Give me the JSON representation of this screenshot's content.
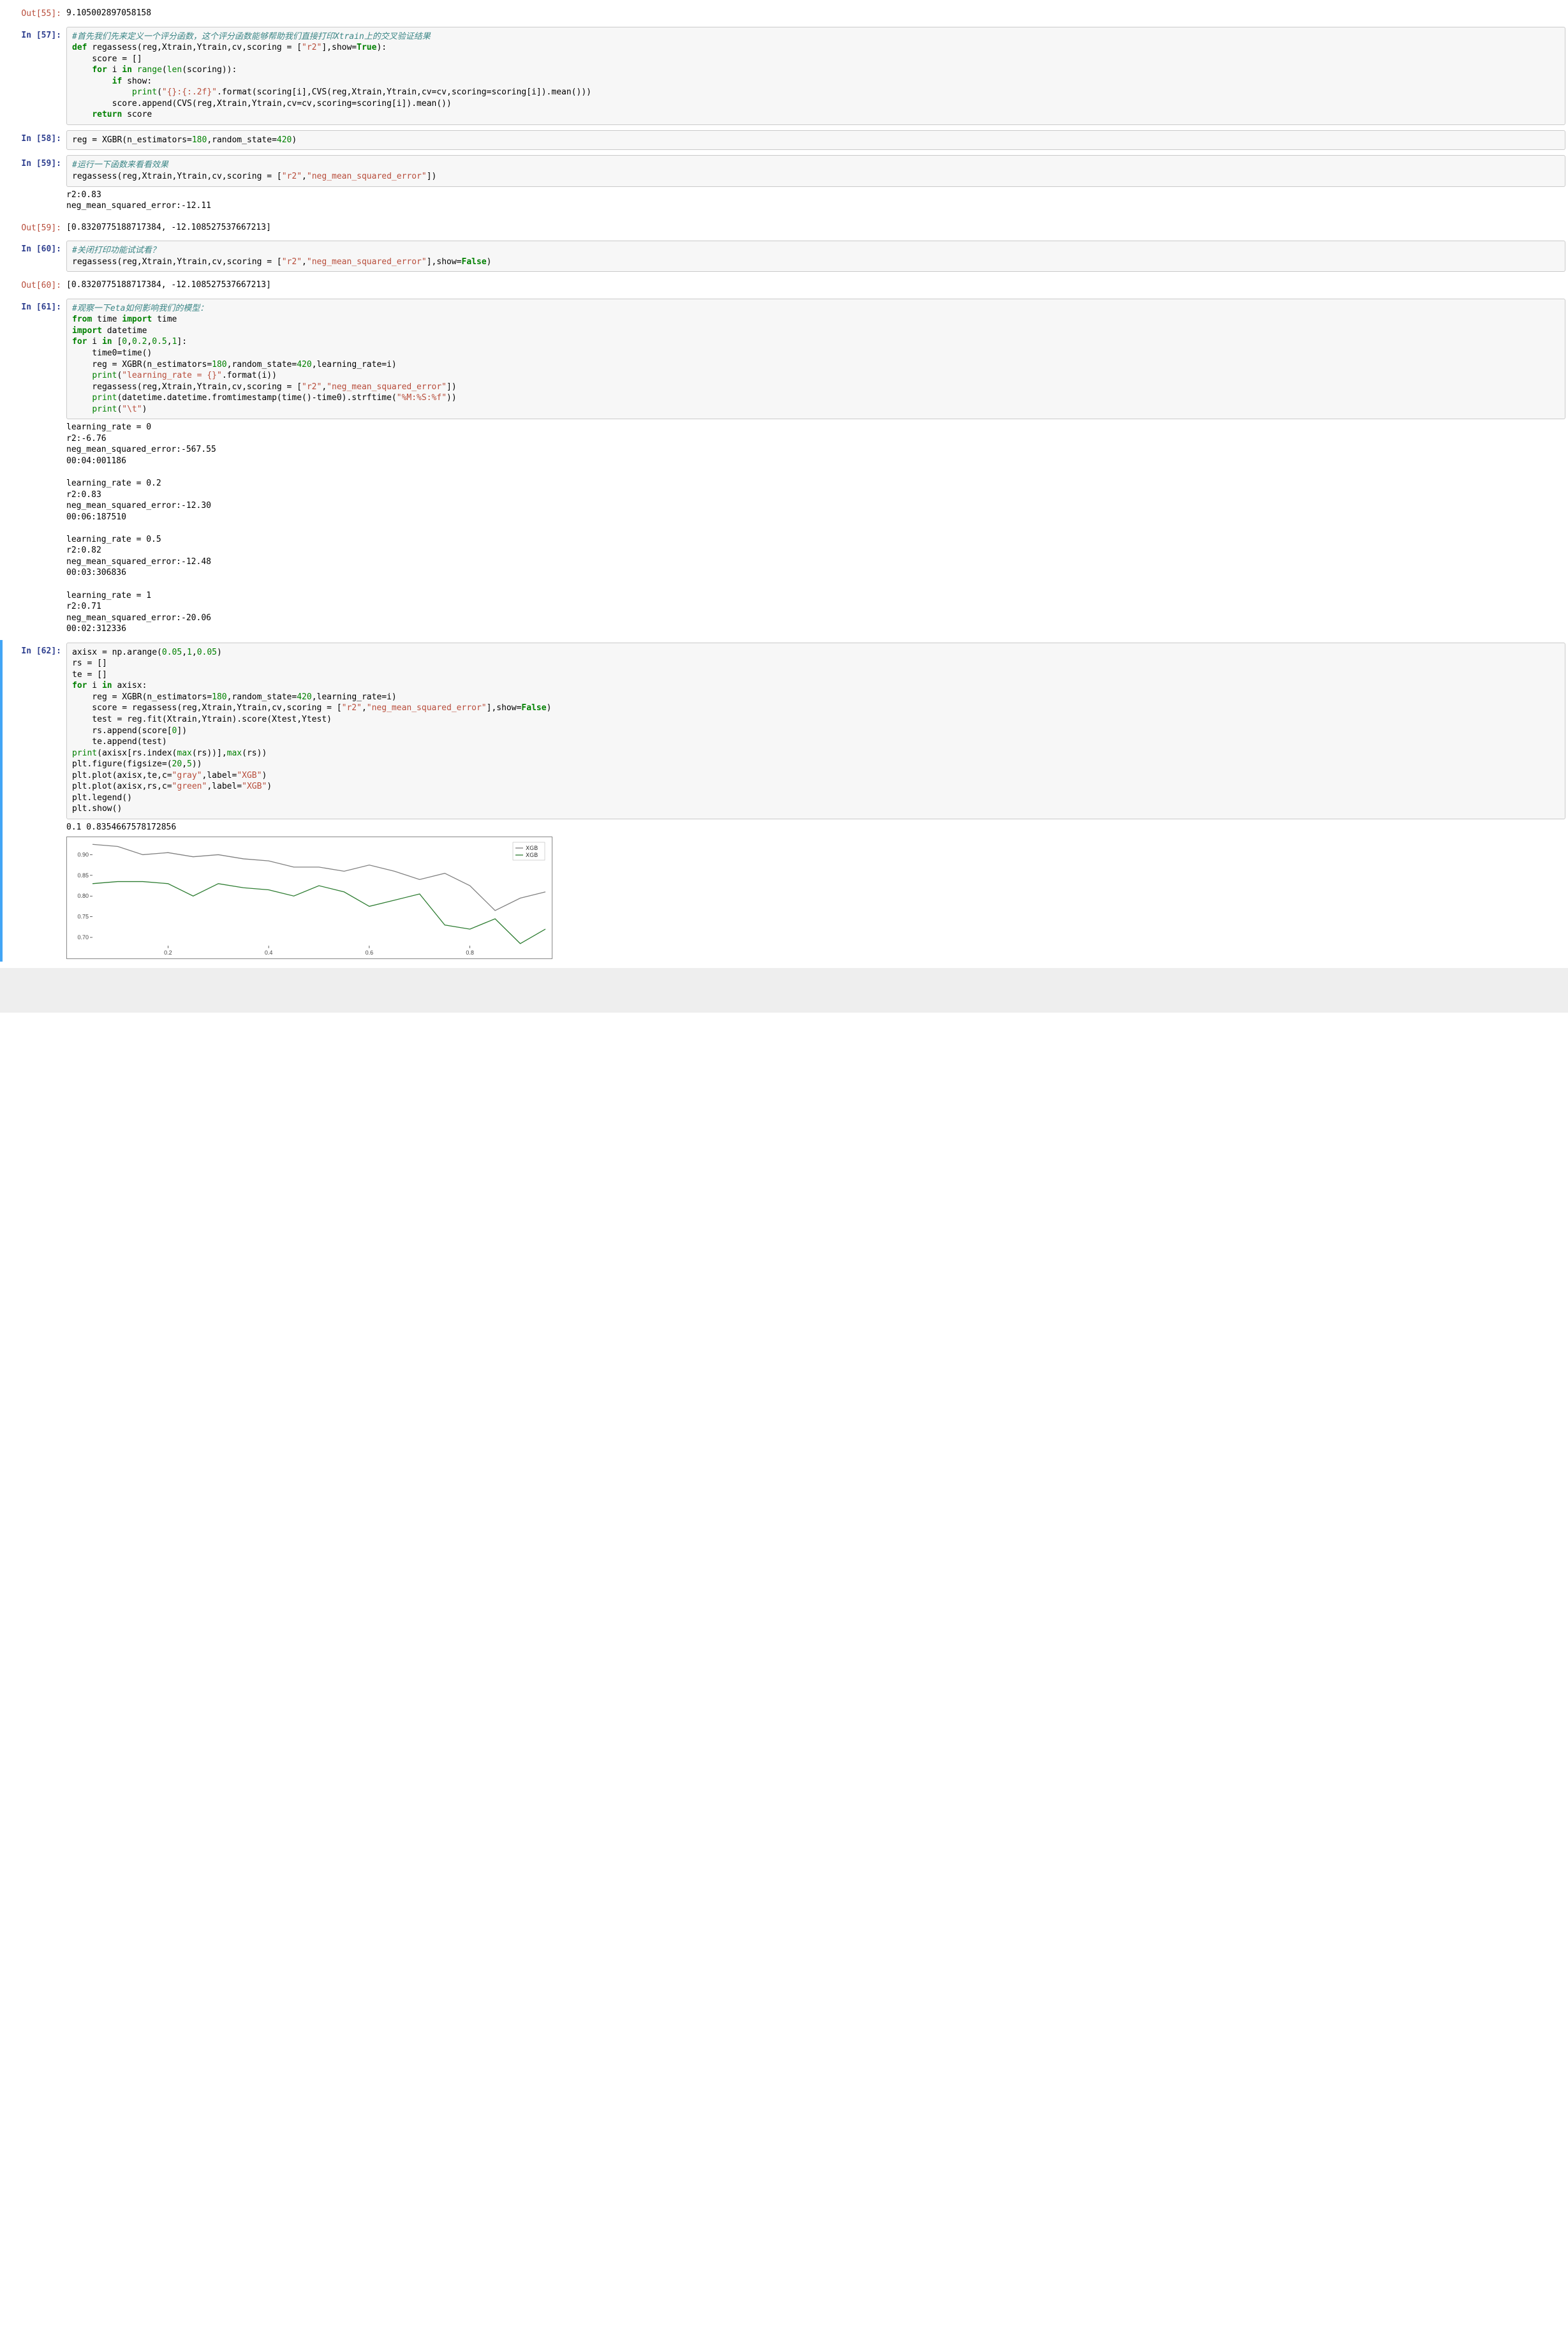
{
  "cells": {
    "out55_prompt": "Out[55]:",
    "out55_text": "9.105002897058158",
    "in57_prompt": "In [57]:",
    "in58_prompt": "In [58]:",
    "in59_prompt": "In [59]:",
    "out59_prompt": "Out[59]:",
    "in60_prompt": "In [60]:",
    "out60_prompt": "Out[60]:",
    "in61_prompt": "In [61]:",
    "in62_prompt": "In [62]:",
    "in57_comment": "#首先我们先来定义一个评分函数，这个评分函数能够帮助我们直接打印Xtrain上的交叉验证结果",
    "in57_l2a": "def",
    "in57_l2b": " regassess(reg,Xtrain,Ytrain,cv,scoring = [",
    "in57_l2c": "\"r2\"",
    "in57_l2d": "],show=",
    "in57_l2e": "True",
    "in57_l2f": "):",
    "in57_l3": "    score = []",
    "in57_l4a": "    ",
    "in57_l4b": "for",
    "in57_l4c": " i ",
    "in57_l4d": "in",
    "in57_l4e": " ",
    "in57_l4f": "range",
    "in57_l4g": "(",
    "in57_l4h": "len",
    "in57_l4i": "(scoring)):",
    "in57_l5a": "        ",
    "in57_l5b": "if",
    "in57_l5c": " show:",
    "in57_l6a": "            ",
    "in57_l6b": "print",
    "in57_l6c": "(",
    "in57_l6d": "\"{}:{:.2f}\"",
    "in57_l6e": ".format(scoring[i],CVS(reg,Xtrain,Ytrain,cv=cv,scoring=scoring[i]).mean()))",
    "in57_l7": "        score.append(CVS(reg,Xtrain,Ytrain,cv=cv,scoring=scoring[i]).mean())",
    "in57_l8a": "    ",
    "in57_l8b": "return",
    "in57_l8c": " score",
    "in58_a": "reg = XGBR(n_estimators=",
    "in58_b": "180",
    "in58_c": ",random_state=",
    "in58_d": "420",
    "in58_e": ")",
    "in59_comment": "#运行一下函数来看看效果",
    "in59_l2a": "regassess(reg,Xtrain,Ytrain,cv,scoring = [",
    "in59_l2b": "\"r2\"",
    "in59_l2c": ",",
    "in59_l2d": "\"neg_mean_squared_error\"",
    "in59_l2e": "])",
    "out59_stdout": "r2:0.83\nneg_mean_squared_error:-12.11",
    "out59_result": "[0.8320775188717384, -12.108527537667213]",
    "in60_comment": "#关闭打印功能试试看？",
    "in60_l2a": "regassess(reg,Xtrain,Ytrain,cv,scoring = [",
    "in60_l2b": "\"r2\"",
    "in60_l2c": ",",
    "in60_l2d": "\"neg_mean_squared_error\"",
    "in60_l2e": "],show=",
    "in60_l2f": "False",
    "in60_l2g": ")",
    "out60_result": "[0.8320775188717384, -12.108527537667213]",
    "in61_comment": "#观察一下eta如何影响我们的模型：",
    "in61_l2a": "from",
    "in61_l2b": " time ",
    "in61_l2c": "import",
    "in61_l2d": " time",
    "in61_l3a": "import",
    "in61_l3b": " datetime",
    "in61_l4a": "for",
    "in61_l4b": " i ",
    "in61_l4c": "in",
    "in61_l4d": " [",
    "in61_l4e": "0",
    "in61_l4f": ",",
    "in61_l4g": "0.2",
    "in61_l4h": ",",
    "in61_l4i": "0.5",
    "in61_l4j": ",",
    "in61_l4k": "1",
    "in61_l4l": "]:",
    "in61_l5": "    time0=time()",
    "in61_l6a": "    reg = XGBR(n_estimators=",
    "in61_l6b": "180",
    "in61_l6c": ",random_state=",
    "in61_l6d": "420",
    "in61_l6e": ",learning_rate=i)",
    "in61_l7a": "    ",
    "in61_l7b": "print",
    "in61_l7c": "(",
    "in61_l7d": "\"learning_rate = {}\"",
    "in61_l7e": ".format(i))",
    "in61_l8a": "    regassess(reg,Xtrain,Ytrain,cv,scoring = [",
    "in61_l8b": "\"r2\"",
    "in61_l8c": ",",
    "in61_l8d": "\"neg_mean_squared_error\"",
    "in61_l8e": "])",
    "in61_l9a": "    ",
    "in61_l9b": "print",
    "in61_l9c": "(datetime.datetime.fromtimestamp(time()-time0).strftime(",
    "in61_l9d": "\"%M:%S:%f\"",
    "in61_l9e": "))",
    "in61_l10a": "    ",
    "in61_l10b": "print",
    "in61_l10c": "(",
    "in61_l10d": "\"\\t\"",
    "in61_l10e": ")",
    "out61_stdout": "learning_rate = 0\nr2:-6.76\nneg_mean_squared_error:-567.55\n00:04:001186\n\nlearning_rate = 0.2\nr2:0.83\nneg_mean_squared_error:-12.30\n00:06:187510\n\nlearning_rate = 0.5\nr2:0.82\nneg_mean_squared_error:-12.48\n00:03:306836\n\nlearning_rate = 1\nr2:0.71\nneg_mean_squared_error:-20.06\n00:02:312336",
    "in62_l1a": "axisx = np.arange(",
    "in62_l1b": "0.05",
    "in62_l1c": ",",
    "in62_l1d": "1",
    "in62_l1e": ",",
    "in62_l1f": "0.05",
    "in62_l1g": ")",
    "in62_l2": "rs = []",
    "in62_l3": "te = []",
    "in62_l4a": "for",
    "in62_l4b": " i ",
    "in62_l4c": "in",
    "in62_l4d": " axisx:",
    "in62_l5a": "    reg = XGBR(n_estimators=",
    "in62_l5b": "180",
    "in62_l5c": ",random_state=",
    "in62_l5d": "420",
    "in62_l5e": ",learning_rate=i)",
    "in62_l6a": "    score = regassess(reg,Xtrain,Ytrain,cv,scoring = [",
    "in62_l6b": "\"r2\"",
    "in62_l6c": ",",
    "in62_l6d": "\"neg_mean_squared_error\"",
    "in62_l6e": "],show=",
    "in62_l6f": "False",
    "in62_l6g": ")",
    "in62_l7": "    test = reg.fit(Xtrain,Ytrain).score(Xtest,Ytest)",
    "in62_l8a": "    rs.append(score[",
    "in62_l8b": "0",
    "in62_l8c": "])",
    "in62_l9": "    te.append(test)",
    "in62_l10a": "print",
    "in62_l10b": "(axisx[rs.index(",
    "in62_l10c": "max",
    "in62_l10d": "(rs))],",
    "in62_l10e": "max",
    "in62_l10f": "(rs))",
    "in62_l11a": "plt.figure(figsize=(",
    "in62_l11b": "20",
    "in62_l11c": ",",
    "in62_l11d": "5",
    "in62_l11e": "))",
    "in62_l12a": "plt.plot(axisx,te,c=",
    "in62_l12b": "\"gray\"",
    "in62_l12c": ",label=",
    "in62_l12d": "\"XGB\"",
    "in62_l12e": ")",
    "in62_l13a": "plt.plot(axisx,rs,c=",
    "in62_l13b": "\"green\"",
    "in62_l13c": ",label=",
    "in62_l13d": "\"XGB\"",
    "in62_l13e": ")",
    "in62_l14": "plt.legend()",
    "in62_l15": "plt.show()",
    "out62_stdout": "0.1 0.8354667578172856"
  },
  "chart_data": {
    "type": "line",
    "x": [
      0.05,
      0.1,
      0.15,
      0.2,
      0.25,
      0.3,
      0.35,
      0.4,
      0.45,
      0.5,
      0.55,
      0.6,
      0.65,
      0.7,
      0.75,
      0.8,
      0.85,
      0.9,
      0.95
    ],
    "series": [
      {
        "name": "XGB",
        "color": "#808080",
        "values": [
          0.925,
          0.92,
          0.9,
          0.905,
          0.895,
          0.9,
          0.89,
          0.885,
          0.87,
          0.87,
          0.86,
          0.875,
          0.86,
          0.84,
          0.855,
          0.825,
          0.765,
          0.795,
          0.81
        ]
      },
      {
        "name": "XGB",
        "color": "#2e7d32",
        "values": [
          0.83,
          0.835,
          0.835,
          0.83,
          0.8,
          0.83,
          0.82,
          0.815,
          0.8,
          0.825,
          0.81,
          0.775,
          0.79,
          0.805,
          0.73,
          0.72,
          0.745,
          0.685,
          0.72
        ]
      }
    ],
    "ylim": [
      0.68,
      0.93
    ],
    "yticks": [
      0.7,
      0.75,
      0.8,
      0.85,
      0.9
    ],
    "xticks": [
      0.2,
      0.4,
      0.6,
      0.8
    ],
    "legend": [
      "XGB",
      "XGB"
    ],
    "legend_pos": "upper-right"
  }
}
